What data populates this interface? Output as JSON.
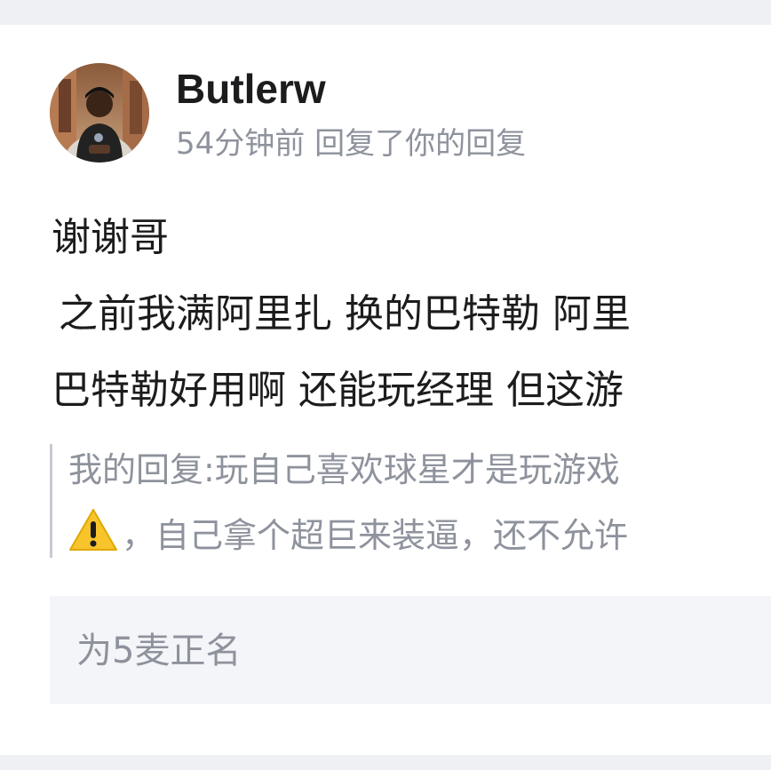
{
  "comment": {
    "username": "Butlerw",
    "time": "54分钟前",
    "action": "回复了你的回复",
    "body_lines": [
      "谢谢哥",
      "之前我满阿里扎 换的巴特勒  阿里",
      "巴特勒好用啊 还能玩经理 但这游"
    ]
  },
  "quote": {
    "line1": "我的回复:玩自己喜欢球星才是玩游戏",
    "line2_icon": "warning-icon",
    "line2": "，自己拿个超巨来装逼，还不允许"
  },
  "reply_box": {
    "text": "为5麦正名"
  },
  "colors": {
    "background": "#eef0f4",
    "card": "#ffffff",
    "text": "#1c1c1e",
    "muted": "#8e929c",
    "reply_bg": "#f4f5f8"
  }
}
